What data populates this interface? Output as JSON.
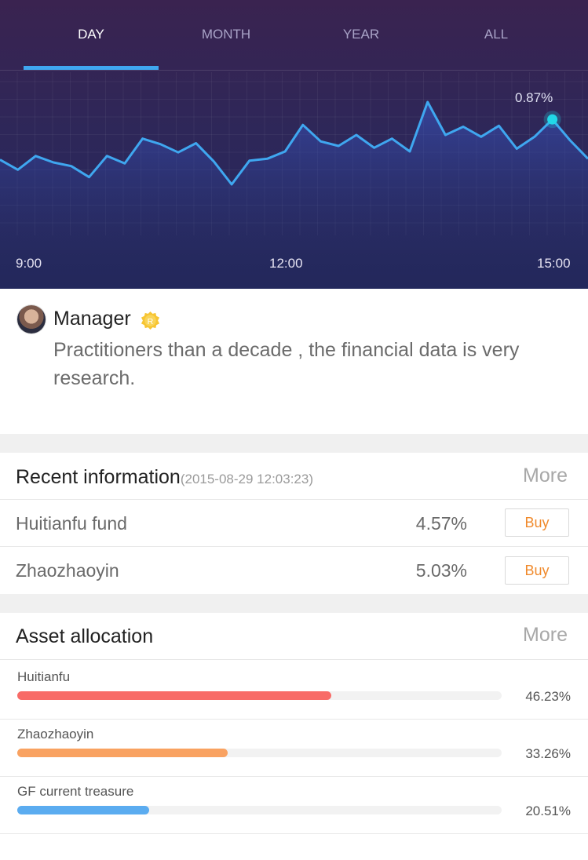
{
  "tabs": [
    {
      "label": "DAY",
      "active": true
    },
    {
      "label": "MONTH",
      "active": false
    },
    {
      "label": "YEAR",
      "active": false
    },
    {
      "label": "ALL",
      "active": false
    }
  ],
  "chart_data": {
    "type": "line",
    "x_labels": [
      "9:00",
      "12:00",
      "15:00"
    ],
    "values": [
      0.43,
      0.32,
      0.47,
      0.4,
      0.36,
      0.24,
      0.47,
      0.39,
      0.66,
      0.6,
      0.51,
      0.61,
      0.41,
      0.16,
      0.42,
      0.44,
      0.52,
      0.81,
      0.63,
      0.58,
      0.7,
      0.56,
      0.66,
      0.52,
      1.06,
      0.7,
      0.79,
      0.68,
      0.8,
      0.55,
      0.68,
      0.87,
      0.64,
      0.44
    ],
    "highlight": {
      "index": 31,
      "label": "0.87%"
    },
    "colors": {
      "line": "#3fa7f0",
      "marker": "#21d8e8"
    }
  },
  "manager": {
    "name": "Manager",
    "badge": "R",
    "description": "Practitioners than a decade , the financial data is very research."
  },
  "recent": {
    "title": "Recent  information",
    "timestamp": "(2015-08-29 12:03:23)",
    "more": "More",
    "items": [
      {
        "name": "Huitianfu fund",
        "percent": "4.57%",
        "action": "Buy"
      },
      {
        "name": "Zhaozhaoyin",
        "percent": "5.03%",
        "action": "Buy"
      }
    ]
  },
  "assets": {
    "title": "Asset allocation",
    "more": "More",
    "items": [
      {
        "name": "Huitianfu",
        "percent": "46.23%",
        "share": 0.648,
        "color": "#f86b67"
      },
      {
        "name": "Zhaozhaoyin",
        "percent": "33.26%",
        "share": 0.434,
        "color": "#f9a261"
      },
      {
        "name": "GF current treasure",
        "percent": "20.51%",
        "share": 0.272,
        "color": "#5bacf0"
      }
    ]
  }
}
